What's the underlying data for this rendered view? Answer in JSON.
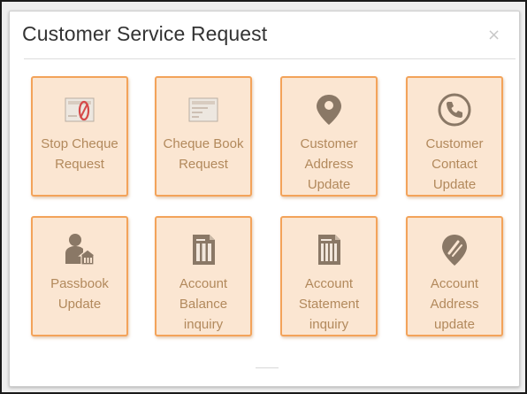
{
  "dialog": {
    "title": "Customer Service Request",
    "close_symbol": "×"
  },
  "tiles": [
    {
      "label": "Stop Cheque Request",
      "icon": "stop-cheque-icon"
    },
    {
      "label": "Cheque Book Request",
      "icon": "cheque-book-icon"
    },
    {
      "label": "Customer Address Update",
      "icon": "location-pin-icon"
    },
    {
      "label": "Customer Contact Update",
      "icon": "phone-icon"
    },
    {
      "label": "Passbook Update",
      "icon": "passbook-icon"
    },
    {
      "label": "Account Balance inquiry",
      "icon": "document-columns-icon"
    },
    {
      "label": "Account Statement inquiry",
      "icon": "statement-icon"
    },
    {
      "label": "Account Address update",
      "icon": "address-tag-icon"
    }
  ],
  "colors": {
    "tile_bg": "#fbe6d2",
    "tile_border": "#f3a35a",
    "label": "#b2895c",
    "icon": "#8a7866"
  }
}
